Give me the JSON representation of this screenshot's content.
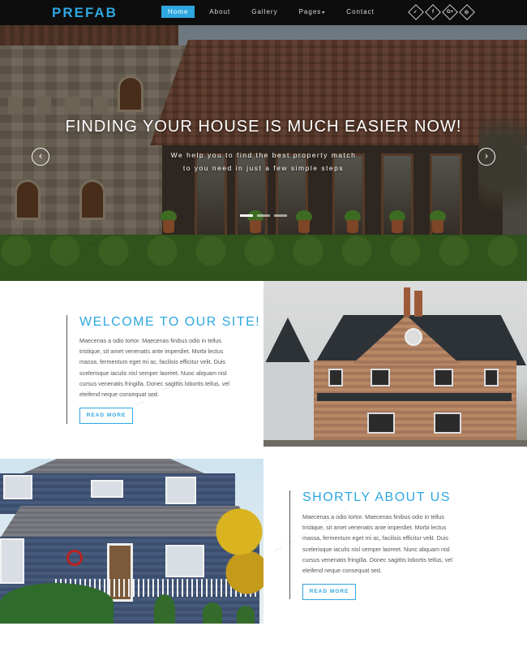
{
  "header": {
    "logo": "PREFAB",
    "nav": [
      {
        "label": "Home",
        "active": true
      },
      {
        "label": "About",
        "active": false
      },
      {
        "label": "Gallery",
        "active": false
      },
      {
        "label": "Pages",
        "active": false,
        "caret": "▾"
      },
      {
        "label": "Contact",
        "active": false
      }
    ],
    "social": [
      {
        "icon": "twitter-icon",
        "glyph": "✓"
      },
      {
        "icon": "facebook-icon",
        "glyph": "f"
      },
      {
        "icon": "google-plus-icon",
        "glyph": "G+"
      },
      {
        "icon": "dribbble-icon",
        "glyph": "◎"
      }
    ]
  },
  "hero": {
    "title": "FINDING YOUR HOUSE IS MUCH EASIER NOW!",
    "subtitle": "We help you to find the best property match to you need in just a few simple steps",
    "prev_arrow": "‹",
    "next_arrow": "›",
    "slides": 3
  },
  "welcome": {
    "title": "WELCOME TO OUR SITE!",
    "text": "Maecenas a odio tortor. Maecenas finibus odio in tellus tristique, sit amet venenatis ante imperdiet. Morbi lectus massa, fermentum eget mi ac, facilisis efficitur velit. Duis scelerisque iaculis nisl semper laoreet. Nunc aliquam nisl cursus venenatis fringilla. Donec sagittis lobortis tellus, vel eleifend neque consequat sed.",
    "button": "READ MORE"
  },
  "about": {
    "title": "SHORTLY ABOUT US",
    "text": "Maecenas a odio tortor. Maecenas finibus odio in tellus tristique, sit amet venenatis ante imperdiet. Morbi lectus massa, fermentum eget mi ac, facilisis efficitur velit. Duis scelerisque iaculis nisl semper laoreet. Nunc aliquam nisl cursus venenatis fringilla. Donec sagittis lobortis tellus, vel eleifend neque consequat sed.",
    "button": "READ MORE"
  },
  "colors": {
    "accent": "#2ea7e0",
    "header_bg": "#0d0d0d"
  }
}
